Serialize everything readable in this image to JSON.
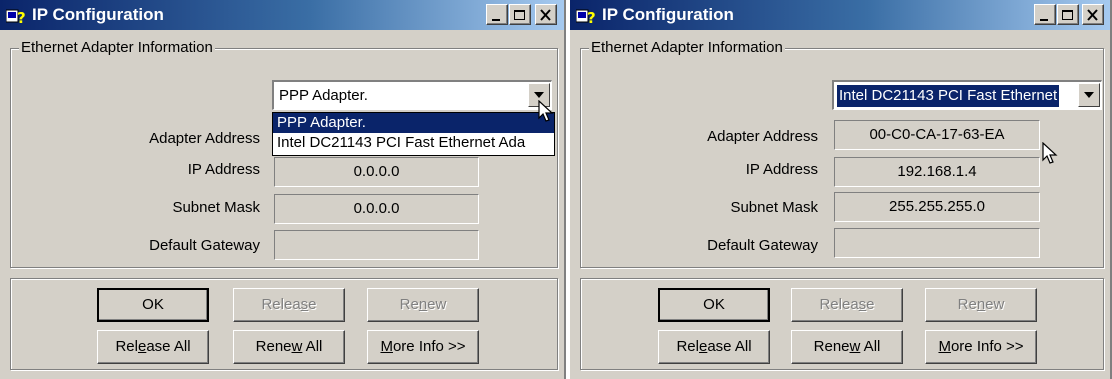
{
  "windows": [
    {
      "title": "IP Configuration",
      "group_label": "Ethernet  Adapter Information",
      "adapter_select": {
        "value": "PPP Adapter.",
        "open": true,
        "options": [
          "PPP Adapter.",
          "Intel DC21143 PCI Fast Ethernet Ada"
        ]
      },
      "fields": {
        "adapter_address_label": "Adapter Address",
        "adapter_address": "",
        "ip_address_label": "IP Address",
        "ip_address": "0.0.0.0",
        "subnet_mask_label": "Subnet Mask",
        "subnet_mask": "0.0.0.0",
        "default_gateway_label": "Default Gateway",
        "default_gateway": ""
      },
      "buttons": {
        "ok": "OK",
        "release_pre": "Relea",
        "release_u": "s",
        "release_post": "e",
        "renew_pre": "Re",
        "renew_u": "n",
        "renew_post": "ew",
        "release_all_pre": "Rel",
        "release_all_u": "e",
        "release_all_post": "ase All",
        "renew_all_pre": "Rene",
        "renew_all_u": "w",
        "renew_all_post": " All",
        "more_info_u": "M",
        "more_info_post": "ore Info >>"
      }
    },
    {
      "title": "IP Configuration",
      "group_label": "Ethernet  Adapter Information",
      "adapter_select": {
        "value": "Intel DC21143 PCI Fast Ethernet",
        "open": false
      },
      "fields": {
        "adapter_address_label": "Adapter Address",
        "adapter_address": "00-C0-CA-17-63-EA",
        "ip_address_label": "IP Address",
        "ip_address": "192.168.1.4",
        "subnet_mask_label": "Subnet Mask",
        "subnet_mask": "255.255.255.0",
        "default_gateway_label": "Default Gateway",
        "default_gateway": ""
      },
      "buttons": {
        "ok": "OK",
        "release_pre": "Relea",
        "release_u": "s",
        "release_post": "e",
        "renew_pre": "Re",
        "renew_u": "n",
        "renew_post": "ew",
        "release_all_pre": "Rel",
        "release_all_u": "e",
        "release_all_post": "ase All",
        "renew_all_pre": "Rene",
        "renew_all_u": "w",
        "renew_all_post": " All",
        "more_info_u": "M",
        "more_info_post": "ore Info >>"
      }
    }
  ],
  "icons": {
    "app": "network-help-icon",
    "minimize": "minimize-icon",
    "maximize": "maximize-icon",
    "close": "close-icon",
    "dropdown": "chevron-down-icon",
    "cursor": "mouse-pointer-icon"
  },
  "colors": {
    "titlebar_start": "#0a246a",
    "titlebar_end": "#a6caf0",
    "face": "#d4d0c8",
    "highlight": "#0a246a"
  }
}
